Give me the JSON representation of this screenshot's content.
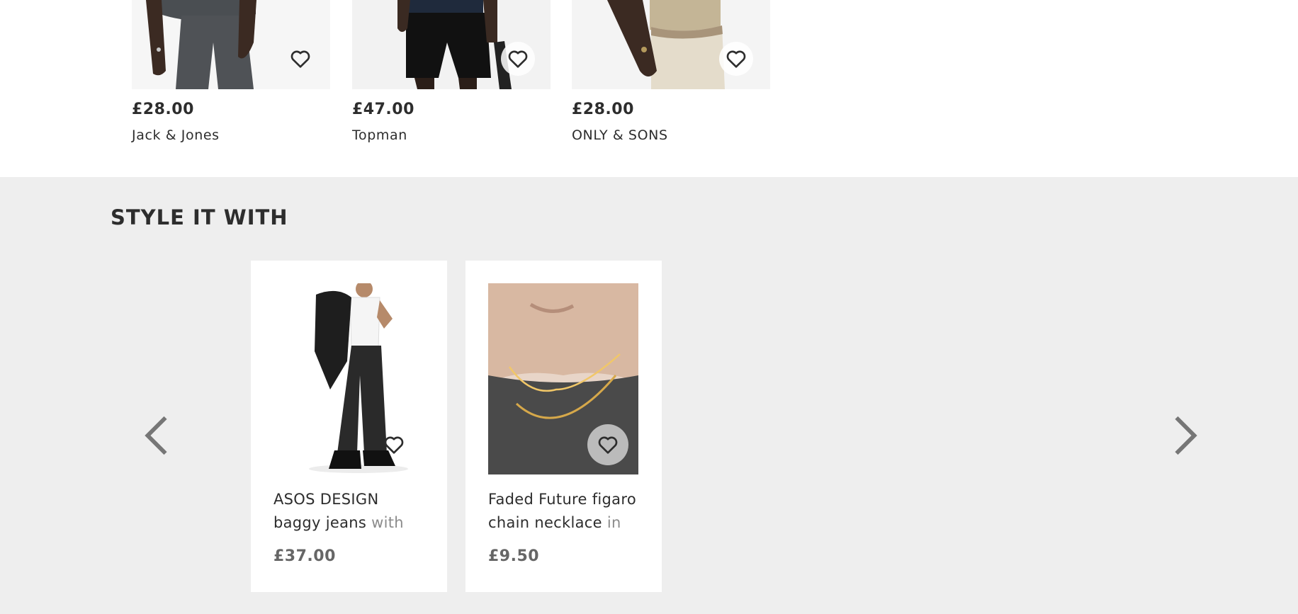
{
  "top_products": [
    {
      "price": "£28.00",
      "brand": "Jack & Jones"
    },
    {
      "price": "£47.00",
      "brand": "Topman"
    },
    {
      "price": "£28.00",
      "brand": "ONLY & SONS"
    }
  ],
  "style_it_with": {
    "title": "STYLE IT WITH",
    "cards": [
      {
        "name_line1": "ASOS DESIGN",
        "name_line2_start": "baggy jeans ",
        "name_line2_fade": "with",
        "price": "£37.00"
      },
      {
        "name_line1": "Faded Future figaro",
        "name_line2_start": "chain necklace ",
        "name_line2_fade": "in",
        "price": "£9.50"
      }
    ]
  },
  "icons": {
    "save": "heart-icon",
    "prev": "chevron-left-icon",
    "next": "chevron-right-icon"
  }
}
